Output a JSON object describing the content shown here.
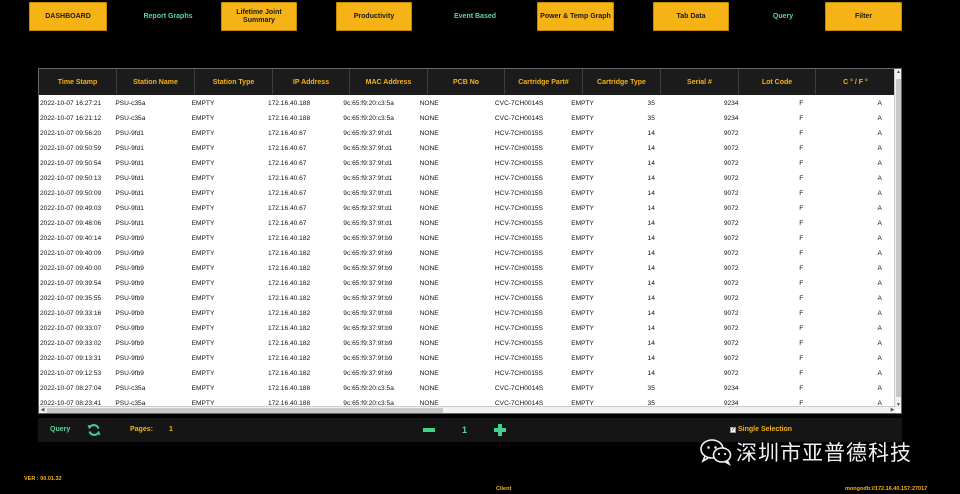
{
  "nav": {
    "tabs": [
      {
        "label": "DASHBOARD",
        "active": true
      },
      {
        "label": "Report Graphs",
        "active": false
      },
      {
        "label": "Lifetime Joint Summary",
        "active": true
      },
      {
        "label": "Productivity",
        "active": true
      },
      {
        "label": "Event Based",
        "active": false
      },
      {
        "label": "Power & Temp Graph",
        "active": true
      },
      {
        "label": "Tab Data",
        "active": true
      },
      {
        "label": "Query",
        "active": false
      },
      {
        "label": "Filter",
        "active": true
      }
    ]
  },
  "table": {
    "columns": [
      "Time Stamp",
      "Station Name",
      "Station Type",
      "IP Address",
      "MAC Address",
      "PCB No",
      "Cartridge Part#",
      "Cartridge Type",
      "Serial #",
      "Lot Code",
      "C ° / F °"
    ],
    "rows": [
      [
        "2022-10-07 16:27:21",
        "PSU-c35a",
        "EMPTY",
        "172.16.40.188",
        "9c:65:f9:20:c3:5a",
        "NONE",
        "CVC-7CH0014S",
        "EMPTY",
        "35",
        "9234",
        "F",
        "A"
      ],
      [
        "2022-10-07 16:21:12",
        "PSU-c35a",
        "EMPTY",
        "172.16.40.188",
        "9c:65:f9:20:c3:5a",
        "NONE",
        "CVC-7CH0014S",
        "EMPTY",
        "35",
        "9234",
        "F",
        "A"
      ],
      [
        "2022-10-07 09:56:20",
        "PSU-9fd1",
        "EMPTY",
        "172.16.40.67",
        "9c:65:f9:37:9f:d1",
        "NONE",
        "HCV-7CH0015S",
        "EMPTY",
        "14",
        "9072",
        "F",
        "A"
      ],
      [
        "2022-10-07 09:50:59",
        "PSU-9fd1",
        "EMPTY",
        "172.16.40.67",
        "9c:65:f9:37:9f:d1",
        "NONE",
        "HCV-7CH0015S",
        "EMPTY",
        "14",
        "9072",
        "F",
        "A"
      ],
      [
        "2022-10-07 09:50:54",
        "PSU-9fd1",
        "EMPTY",
        "172.16.40.67",
        "9c:65:f9:37:9f:d1",
        "NONE",
        "HCV-7CH0015S",
        "EMPTY",
        "14",
        "9072",
        "F",
        "A"
      ],
      [
        "2022-10-07 09:50:13",
        "PSU-9fd1",
        "EMPTY",
        "172.16.40.67",
        "9c:65:f9:37:9f:d1",
        "NONE",
        "HCV-7CH0015S",
        "EMPTY",
        "14",
        "9072",
        "F",
        "A"
      ],
      [
        "2022-10-07 09:50:09",
        "PSU-9fd1",
        "EMPTY",
        "172.16.40.67",
        "9c:65:f9:37:9f:d1",
        "NONE",
        "HCV-7CH0015S",
        "EMPTY",
        "14",
        "9072",
        "F",
        "A"
      ],
      [
        "2022-10-07 09:49:03",
        "PSU-9fd1",
        "EMPTY",
        "172.16.40.67",
        "9c:65:f9:37:9f:d1",
        "NONE",
        "HCV-7CH0015S",
        "EMPTY",
        "14",
        "9072",
        "F",
        "A"
      ],
      [
        "2022-10-07 09:48:06",
        "PSU-9fd1",
        "EMPTY",
        "172.16.40.67",
        "9c:65:f9:37:9f:d1",
        "NONE",
        "HCV-7CH0015S",
        "EMPTY",
        "14",
        "9072",
        "F",
        "A"
      ],
      [
        "2022-10-07 09:40:14",
        "PSU-9fb9",
        "EMPTY",
        "172.16.40.182",
        "9c:65:f9:37:9f:b9",
        "NONE",
        "HCV-7CH0015S",
        "EMPTY",
        "14",
        "9072",
        "F",
        "A"
      ],
      [
        "2022-10-07 09:40:09",
        "PSU-9fb9",
        "EMPTY",
        "172.16.40.182",
        "9c:65:f9:37:9f:b9",
        "NONE",
        "HCV-7CH0015S",
        "EMPTY",
        "14",
        "9072",
        "F",
        "A"
      ],
      [
        "2022-10-07 09:40:00",
        "PSU-9fb9",
        "EMPTY",
        "172.16.40.182",
        "9c:65:f9:37:9f:b9",
        "NONE",
        "HCV-7CH0015S",
        "EMPTY",
        "14",
        "9072",
        "F",
        "A"
      ],
      [
        "2022-10-07 09:39:54",
        "PSU-9fb9",
        "EMPTY",
        "172.16.40.182",
        "9c:65:f9:37:9f:b9",
        "NONE",
        "HCV-7CH0015S",
        "EMPTY",
        "14",
        "9072",
        "F",
        "A"
      ],
      [
        "2022-10-07 09:35:55",
        "PSU-9fb9",
        "EMPTY",
        "172.16.40.182",
        "9c:65:f9:37:9f:b9",
        "NONE",
        "HCV-7CH0015S",
        "EMPTY",
        "14",
        "9072",
        "F",
        "A"
      ],
      [
        "2022-10-07 09:33:16",
        "PSU-9fb9",
        "EMPTY",
        "172.16.40.182",
        "9c:65:f9:37:9f:b9",
        "NONE",
        "HCV-7CH0015S",
        "EMPTY",
        "14",
        "9072",
        "F",
        "A"
      ],
      [
        "2022-10-07 09:33:07",
        "PSU-9fb9",
        "EMPTY",
        "172.16.40.182",
        "9c:65:f9:37:9f:b9",
        "NONE",
        "HCV-7CH0015S",
        "EMPTY",
        "14",
        "9072",
        "F",
        "A"
      ],
      [
        "2022-10-07 09:33:02",
        "PSU-9fb9",
        "EMPTY",
        "172.16.40.182",
        "9c:65:f9:37:9f:b9",
        "NONE",
        "HCV-7CH0015S",
        "EMPTY",
        "14",
        "9072",
        "F",
        "A"
      ],
      [
        "2022-10-07 09:13:31",
        "PSU-9fb9",
        "EMPTY",
        "172.16.40.182",
        "9c:65:f9:37:9f:b9",
        "NONE",
        "HCV-7CH0015S",
        "EMPTY",
        "14",
        "9072",
        "F",
        "A"
      ],
      [
        "2022-10-07 09:12:53",
        "PSU-9fb9",
        "EMPTY",
        "172.16.40.182",
        "9c:65:f9:37:9f:b9",
        "NONE",
        "HCV-7CH0015S",
        "EMPTY",
        "14",
        "9072",
        "F",
        "A"
      ],
      [
        "2022-10-07 08:27:04",
        "PSU-c35a",
        "EMPTY",
        "172.16.40.188",
        "9c:65:f9:20:c3:5a",
        "NONE",
        "CVC-7CH0014S",
        "EMPTY",
        "35",
        "9234",
        "F",
        "A"
      ],
      [
        "2022-10-07 08:23:41",
        "PSU-c35a",
        "EMPTY",
        "172.16.40.188",
        "9c:65:f9:20:c3:5a",
        "NONE",
        "CVC-7CH0014S",
        "EMPTY",
        "35",
        "9234",
        "F",
        "A"
      ]
    ]
  },
  "bottom_bar": {
    "query_label": "Query",
    "pages_label": "Pages:",
    "pages_value": "1",
    "current_page": "1",
    "single_selection_label": "Single Selection",
    "single_selection_checked": true
  },
  "footer": {
    "version": "VER : 00.01.32",
    "client": "Client",
    "db": "mongodb://172.16.40.157:27017"
  },
  "watermark": {
    "text": "深圳市亚普德科技",
    "icon": "wechat-icon"
  },
  "colors": {
    "accent": "#f5b316",
    "green": "#5bd6a0",
    "background": "#000000"
  }
}
